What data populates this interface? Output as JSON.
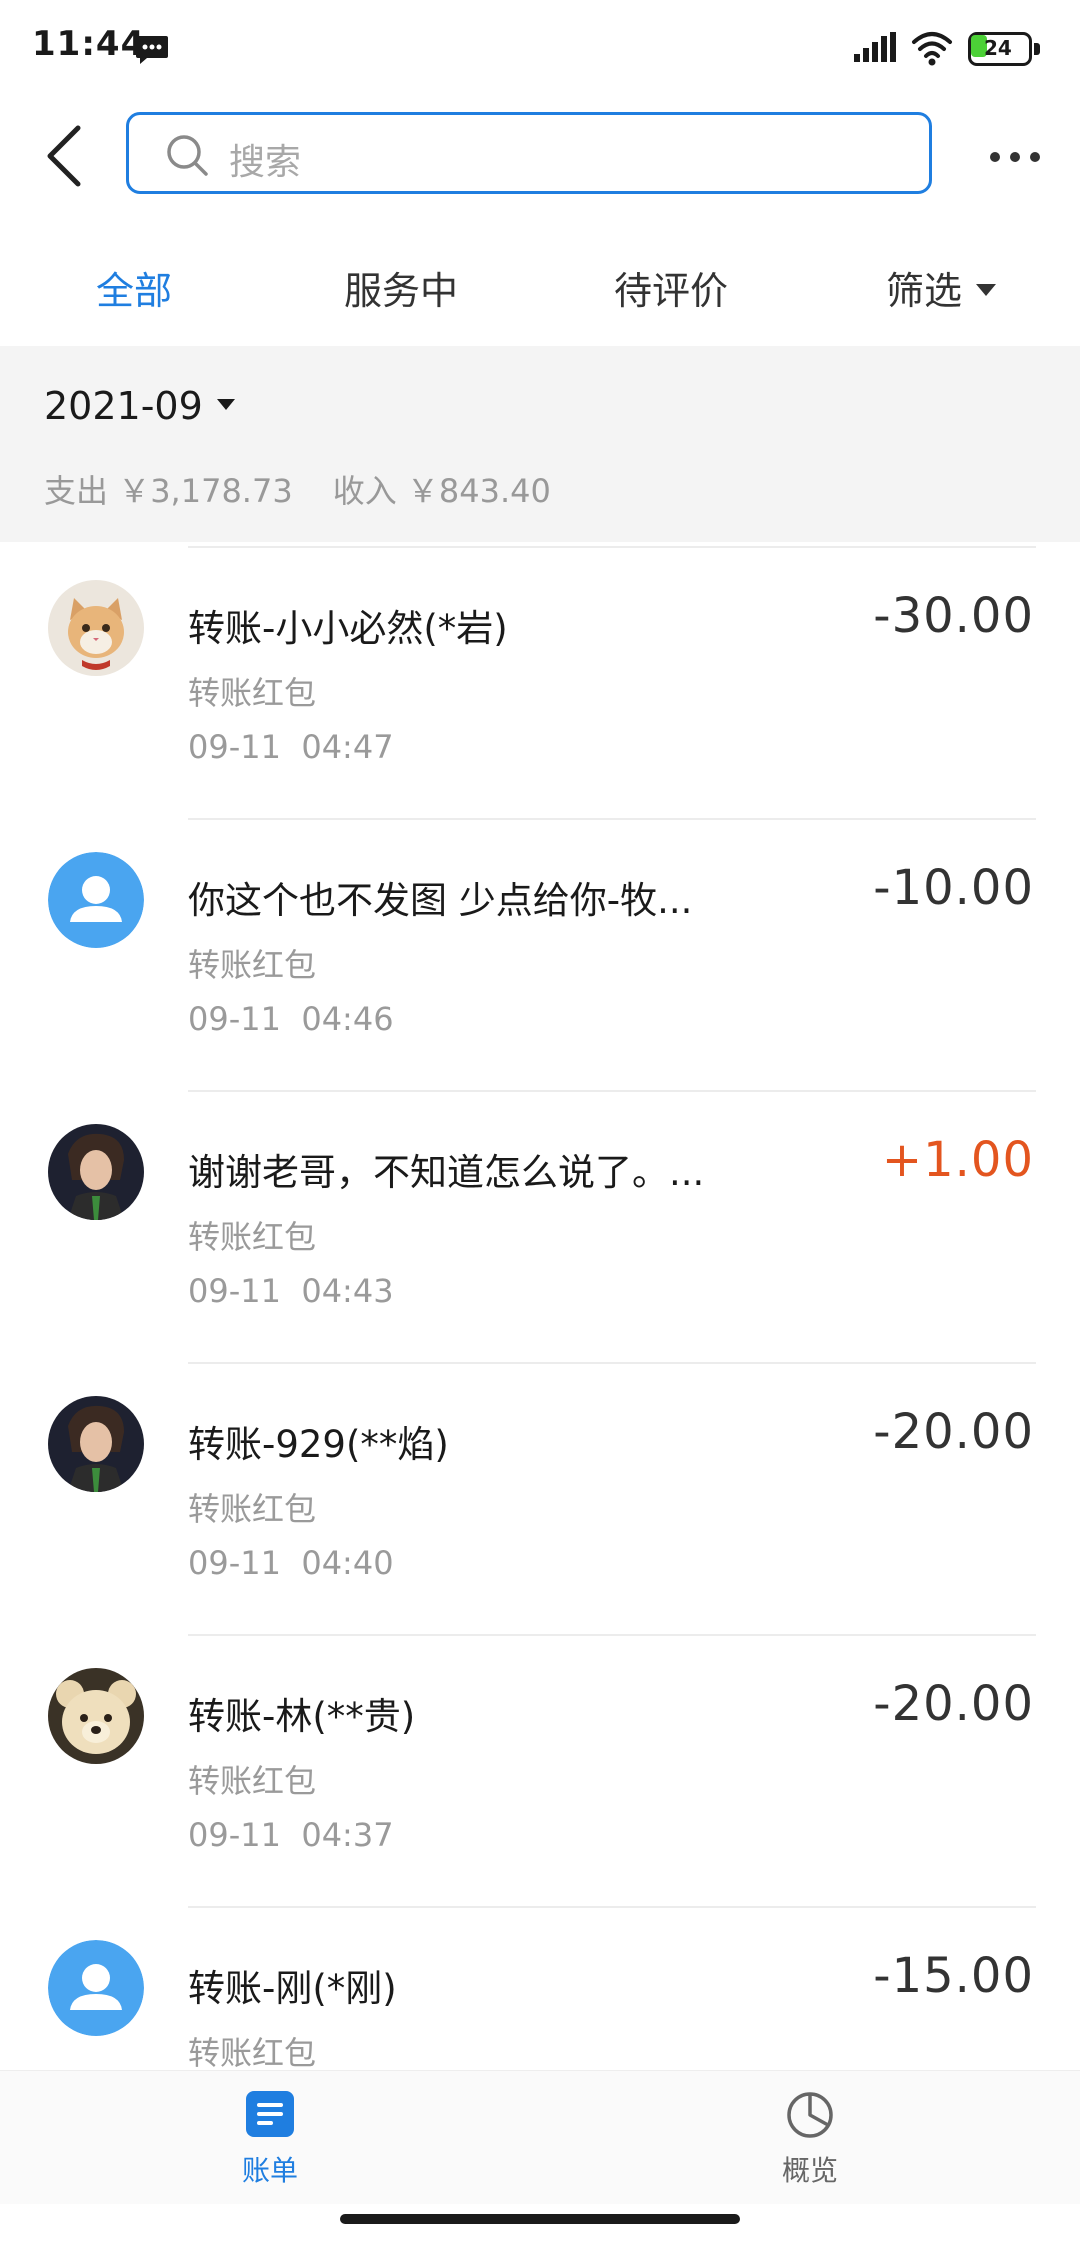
{
  "status_bar": {
    "time": "11:44",
    "battery": "24"
  },
  "header": {
    "search_placeholder": "搜索"
  },
  "tabs": [
    {
      "label": "全部",
      "active": true
    },
    {
      "label": "服务中",
      "active": false
    },
    {
      "label": "待评价",
      "active": false
    },
    {
      "label": "筛选",
      "active": false
    }
  ],
  "summary": {
    "month": "2021-09",
    "expense_label": "支出",
    "expense_value": "￥3,178.73",
    "income_label": "收入",
    "income_value": "￥843.40"
  },
  "transactions": [
    {
      "title": "转账-小小必然(*岩)",
      "subtitle": "转账红包",
      "date": "09-11",
      "time": "04:47",
      "amount": "-30.00",
      "type": "expense",
      "avatar": "cat-avatar"
    },
    {
      "title": "你这个也不发图 少点给你-牧...",
      "subtitle": "转账红包",
      "date": "09-11",
      "time": "04:46",
      "amount": "-10.00",
      "type": "expense",
      "avatar": "default-avatar"
    },
    {
      "title": "谢谢老哥，不知道怎么说了。...",
      "subtitle": "转账红包",
      "date": "09-11",
      "time": "04:43",
      "amount": "+1.00",
      "type": "income",
      "avatar": "photo-avatar"
    },
    {
      "title": "转账-929(**焰)",
      "subtitle": "转账红包",
      "date": "09-11",
      "time": "04:40",
      "amount": "-20.00",
      "type": "expense",
      "avatar": "photo-avatar"
    },
    {
      "title": "转账-林(**贵)",
      "subtitle": "转账红包",
      "date": "09-11",
      "time": "04:37",
      "amount": "-20.00",
      "type": "expense",
      "avatar": "teddy-bear-avatar"
    },
    {
      "title": "转账-刚(*刚)",
      "subtitle": "转账红包",
      "date": "",
      "time": "",
      "amount": "-15.00",
      "type": "expense",
      "avatar": "default-avatar"
    }
  ],
  "bottom_nav": [
    {
      "label": "账单",
      "icon": "bill-list-icon",
      "active": true
    },
    {
      "label": "概览",
      "icon": "pie-chart-icon",
      "active": false
    }
  ],
  "colors": {
    "accent": "#1f7ee0",
    "income": "#e3551f",
    "summary_bg": "#f4f4f4"
  }
}
